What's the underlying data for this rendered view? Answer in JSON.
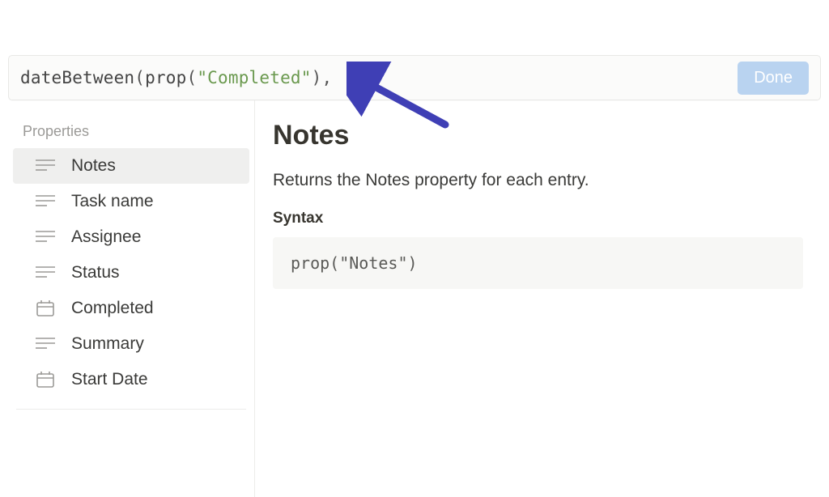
{
  "formula": {
    "tokens": {
      "fn": "dateBetween",
      "open1": "(",
      "propfn": "prop",
      "open2": "(",
      "string": "\"Completed\"",
      "close2": ")",
      "comma": ","
    },
    "done_label": "Done"
  },
  "sidebar": {
    "section_label": "Properties",
    "items": [
      {
        "label": "Notes",
        "icon": "text",
        "selected": true
      },
      {
        "label": "Task name",
        "icon": "text",
        "selected": false
      },
      {
        "label": "Assignee",
        "icon": "text",
        "selected": false
      },
      {
        "label": "Status",
        "icon": "text",
        "selected": false
      },
      {
        "label": "Completed",
        "icon": "date",
        "selected": false
      },
      {
        "label": "Summary",
        "icon": "text",
        "selected": false
      },
      {
        "label": "Start Date",
        "icon": "date",
        "selected": false
      }
    ]
  },
  "detail": {
    "title": "Notes",
    "description": "Returns the Notes property for each entry.",
    "syntax_label": "Syntax",
    "syntax_code": "prop(\"Notes\")"
  },
  "annotation": {
    "color": "#3f3fb5"
  }
}
